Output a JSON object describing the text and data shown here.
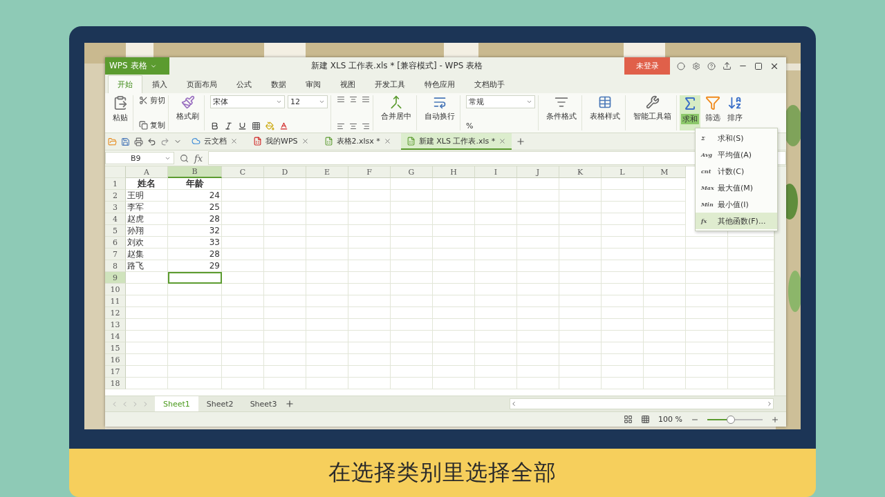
{
  "window": {
    "app_menu": "WPS 表格",
    "title": "新建 XLS 工作表.xls * [兼容模式] - WPS 表格",
    "login_button": "未登录"
  },
  "ribbon_tabs": [
    {
      "label": "开始",
      "selected": true
    },
    {
      "label": "插入",
      "selected": false
    },
    {
      "label": "页面布局",
      "selected": false
    },
    {
      "label": "公式",
      "selected": false
    },
    {
      "label": "数据",
      "selected": false
    },
    {
      "label": "审阅",
      "selected": false
    },
    {
      "label": "视图",
      "selected": false
    },
    {
      "label": "开发工具",
      "selected": false
    },
    {
      "label": "特色应用",
      "selected": false
    },
    {
      "label": "文档助手",
      "selected": false
    }
  ],
  "ribbon": {
    "paste": "粘贴",
    "cut": "剪切",
    "copy": "复制",
    "format_painter": "格式刷",
    "font_name": "宋体",
    "font_size": "12",
    "merge": "合并居中",
    "wrap": "自动换行",
    "number_format": "常规",
    "percent": "%",
    "conditional_format": "条件格式",
    "table_style": "表格样式",
    "toolbox": "智能工具箱",
    "sum": {
      "label": "求和",
      "open": true
    },
    "filter": "筛选",
    "sort": "排序"
  },
  "doc_tabs": [
    {
      "label": "云文档",
      "selected": false
    },
    {
      "label": "我的WPS",
      "selected": false
    },
    {
      "label": "表格2.xlsx *",
      "selected": false
    },
    {
      "label": "新建 XLS 工作表.xls *",
      "selected": true
    }
  ],
  "formula_bar": {
    "cell_ref": "B9",
    "fx": "fx"
  },
  "columns": [
    {
      "letter": "A",
      "selected": false
    },
    {
      "letter": "B",
      "selected": true
    },
    {
      "letter": "C",
      "selected": false
    },
    {
      "letter": "D",
      "selected": false
    },
    {
      "letter": "E",
      "selected": false
    },
    {
      "letter": "F",
      "selected": false
    },
    {
      "letter": "G",
      "selected": false
    },
    {
      "letter": "H",
      "selected": false
    },
    {
      "letter": "I",
      "selected": false
    },
    {
      "letter": "J",
      "selected": false
    },
    {
      "letter": "K",
      "selected": false
    },
    {
      "letter": "L",
      "selected": false
    },
    {
      "letter": "M",
      "selected": false
    }
  ],
  "rows": [
    {
      "number": "1",
      "selected": false,
      "kind": "header",
      "cells": [
        "姓名",
        "年龄"
      ]
    },
    {
      "number": "2",
      "selected": false,
      "kind": "data",
      "cells": [
        "王明",
        "24"
      ]
    },
    {
      "number": "3",
      "selected": false,
      "kind": "data",
      "cells": [
        "李军",
        "25"
      ]
    },
    {
      "number": "4",
      "selected": false,
      "kind": "data",
      "cells": [
        "赵虎",
        "28"
      ]
    },
    {
      "number": "5",
      "selected": false,
      "kind": "data",
      "cells": [
        "孙翔",
        "32"
      ]
    },
    {
      "number": "6",
      "selected": false,
      "kind": "data",
      "cells": [
        "刘欢",
        "33"
      ]
    },
    {
      "number": "7",
      "selected": false,
      "kind": "data",
      "cells": [
        "赵集",
        "28"
      ]
    },
    {
      "number": "8",
      "selected": false,
      "kind": "data",
      "cells": [
        "路飞",
        "29"
      ]
    },
    {
      "number": "9",
      "selected": true,
      "kind": "data",
      "cells": []
    },
    {
      "number": "10",
      "selected": false,
      "kind": "data",
      "cells": []
    },
    {
      "number": "11",
      "selected": false,
      "kind": "data",
      "cells": []
    },
    {
      "number": "12",
      "selected": false,
      "kind": "data",
      "cells": []
    },
    {
      "number": "13",
      "selected": false,
      "kind": "data",
      "cells": []
    },
    {
      "number": "14",
      "selected": false,
      "kind": "data",
      "cells": []
    },
    {
      "number": "15",
      "selected": false,
      "kind": "data",
      "cells": []
    },
    {
      "number": "16",
      "selected": false,
      "kind": "data",
      "cells": []
    },
    {
      "number": "17",
      "selected": false,
      "kind": "data",
      "cells": []
    },
    {
      "number": "18",
      "selected": false,
      "kind": "data",
      "cells": []
    }
  ],
  "sum_menu": [
    {
      "badge": "Σ",
      "label": "求和(S)",
      "highlighted": false
    },
    {
      "badge": "Avg",
      "label": "平均值(A)",
      "highlighted": false
    },
    {
      "badge": "cnt",
      "label": "计数(C)",
      "highlighted": false
    },
    {
      "badge": "Max",
      "label": "最大值(M)",
      "highlighted": false
    },
    {
      "badge": "Min",
      "label": "最小值(I)",
      "highlighted": false
    },
    {
      "badge": "fx",
      "label": "其他函数(F)...",
      "highlighted": true
    }
  ],
  "sheet_tabs": [
    {
      "label": "Sheet1",
      "selected": true
    },
    {
      "label": "Sheet2",
      "selected": false
    },
    {
      "label": "Sheet3",
      "selected": false
    }
  ],
  "status_bar": {
    "zoom": "100 %",
    "zoom_level": {
      "level": 0.42
    }
  },
  "caption": "在选择类别里选择全部"
}
